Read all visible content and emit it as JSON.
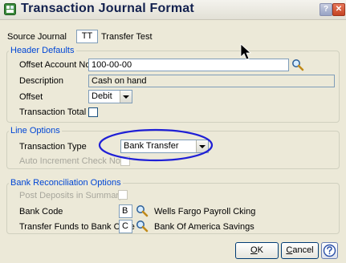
{
  "window": {
    "title": "Transaction Journal Format",
    "help_glyph": "?",
    "close_glyph": "✕"
  },
  "source_journal": {
    "label": "Source Journal",
    "code": "TT",
    "name": "Transfer Test"
  },
  "header_defaults": {
    "title": "Header Defaults",
    "offset_account": {
      "label": "Offset Account No.",
      "value": "100-00-00"
    },
    "description": {
      "label": "Description",
      "value": "Cash on hand"
    },
    "offset": {
      "label": "Offset",
      "value": "Debit"
    },
    "transaction_total": {
      "label": "Transaction Total",
      "checked": false
    }
  },
  "line_options": {
    "title": "Line Options",
    "transaction_type": {
      "label": "Transaction Type",
      "value": "Bank Transfer"
    },
    "auto_increment": {
      "label": "Auto Increment Check No.",
      "checked": false
    }
  },
  "bank_reconciliation": {
    "title": "Bank Reconciliation Options",
    "post_deposits": {
      "label": "Post Deposits in Summary",
      "checked": false
    },
    "bank_code": {
      "label": "Bank Code",
      "value": "B",
      "name": "Wells Fargo Payroll Cking"
    },
    "transfer_funds": {
      "label": "Transfer Funds to Bank Code",
      "value": "C",
      "name": "Bank Of America Savings"
    }
  },
  "buttons": {
    "ok_mnemonic": "O",
    "ok_rest": "K",
    "cancel_mnemonic": "C",
    "cancel_rest": "ancel"
  },
  "colors": {
    "window_bg": "#ece9d8",
    "group_title": "#0046d5",
    "annotation_circle": "#1f1fd6"
  },
  "icons": [
    "app-icon",
    "help-icon",
    "close-icon",
    "lookup-magnifier-icon",
    "mouse-cursor-icon"
  ]
}
